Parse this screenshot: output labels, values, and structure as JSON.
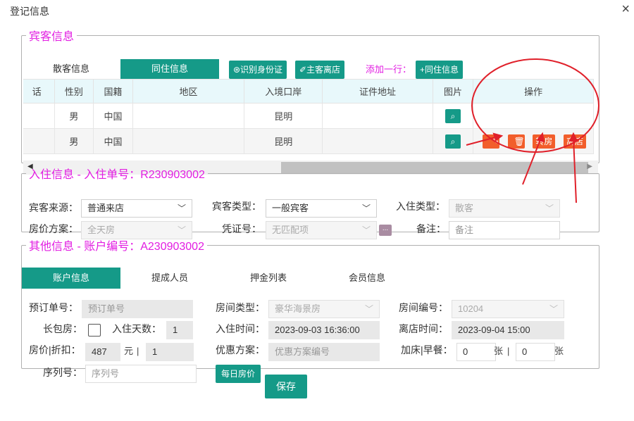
{
  "dialog": {
    "title": "登记信息",
    "close": "×"
  },
  "guest": {
    "legend": "宾客信息",
    "tabs": [
      "散客信息",
      "同住信息"
    ],
    "buttons": {
      "id_card": "⊛识别身份证",
      "main_checkout": "✐主客离店",
      "add_label": "添加一行：",
      "add_cohabit": "+同住信息"
    },
    "columns": [
      "话",
      "性别",
      "国籍",
      "地区",
      "入境口岸",
      "证件地址",
      "图片",
      "操作"
    ],
    "rows": [
      {
        "phone": "",
        "gender": "男",
        "nation": "中国",
        "region": "",
        "port": "昆明",
        "address": ""
      },
      {
        "phone": "",
        "gender": "男",
        "nation": "中国",
        "region": "",
        "port": "昆明",
        "address": ""
      }
    ],
    "ops": {
      "edit": "✎",
      "delete": "🗑",
      "transfer": "转房",
      "checkout": "离店"
    },
    "scroll": {
      "left": "◀",
      "right": "▶"
    }
  },
  "checkin": {
    "legend": "入住信息 - 入住单号：R230903002",
    "source_label": "宾客来源：",
    "source_value": "普通来店",
    "type_label": "宾客类型：",
    "type_value": "一般宾客",
    "stay_label": "入住类型：",
    "stay_value": "散客",
    "rate_label": "房价方案：",
    "rate_value": "全天房",
    "voucher_label": "凭证号：",
    "voucher_value": "无匹配项",
    "more": "...",
    "remark_label": "备注：",
    "remark_placeholder": "备注"
  },
  "other": {
    "legend": "其他信息 - 账户编号：A230903002",
    "tabs": [
      "账户信息",
      "提成人员",
      "押金列表",
      "会员信息"
    ],
    "booking_label": "预订单号：",
    "booking_placeholder": "预订单号",
    "roomtype_label": "房间类型：",
    "roomtype_value": "豪华海景房",
    "roomno_label": "房间编号：",
    "roomno_value": "10204",
    "longstay_label": "长包房：",
    "days_label": "入住天数：",
    "days_value": "1",
    "checkin_label": "入住时间：",
    "checkin_value": "2023-09-03 16:36:00",
    "checkout_label": "离店时间：",
    "checkout_value": "2023-09-04 15:00",
    "price_label": "房价|折扣：",
    "price_value": "487",
    "price_unit": "元",
    "sep": "|",
    "discount_value": "1",
    "promo_label": "优惠方案：",
    "promo_placeholder": "优惠方案编号",
    "extra_label": "加床|早餐：",
    "extra_bed": "0",
    "extra_unit": "张",
    "breakfast": "0",
    "breakfast_unit": "张",
    "serial_label": "序列号：",
    "serial_placeholder": "序列号",
    "daily_price": "每日房价"
  },
  "save": "保存",
  "colors": {
    "primary": "#159a88",
    "danger": "#f25e2b",
    "legend": "#e21de2",
    "annotation": "#e0202a"
  }
}
